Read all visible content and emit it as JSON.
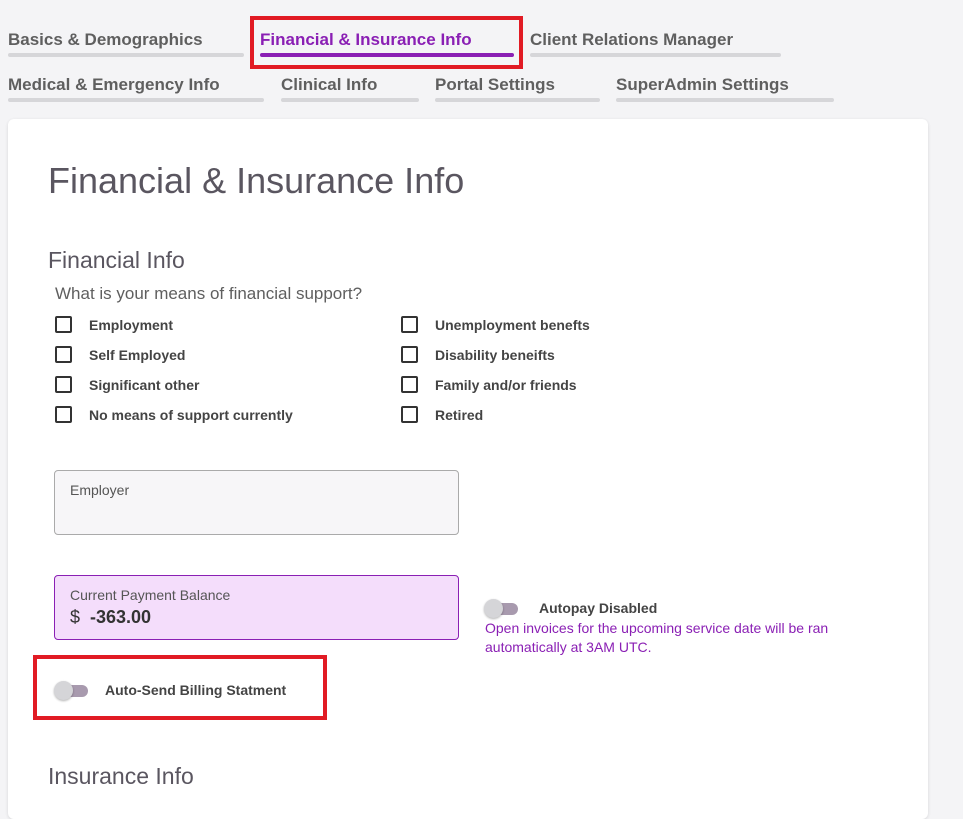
{
  "tabs": [
    {
      "label": "Basics & Demographics"
    },
    {
      "label": "Financial & Insurance Info"
    },
    {
      "label": "Client Relations Manager"
    },
    {
      "label": "Medical & Emergency Info"
    },
    {
      "label": "Clinical Info"
    },
    {
      "label": "Portal Settings"
    },
    {
      "label": "SuperAdmin Settings"
    }
  ],
  "page": {
    "title": "Financial & Insurance Info",
    "financial_heading": "Financial Info",
    "question": "What is your means of financial support?",
    "options_left": [
      "Employment",
      "Self Employed",
      "Significant other",
      "No means of support currently"
    ],
    "options_right": [
      "Unemployment benefts",
      "Disability beneifts",
      "Family and/or friends",
      "Retired"
    ],
    "employer_label": "Employer",
    "employer_value": "",
    "balance_label": "Current Payment Balance",
    "balance_currency": "$",
    "balance_value": "-363.00",
    "autopay_label": "Autopay Disabled",
    "autopay_note": "Open invoices for the upcoming service date will be ran automatically at 3AM UTC.",
    "auto_send_label": "Auto-Send Billing Statment",
    "insurance_heading": "Insurance Info"
  },
  "colors": {
    "accent": "#8a1fb4",
    "highlight": "#e11b24",
    "balance_bg": "#f4ddfb"
  }
}
